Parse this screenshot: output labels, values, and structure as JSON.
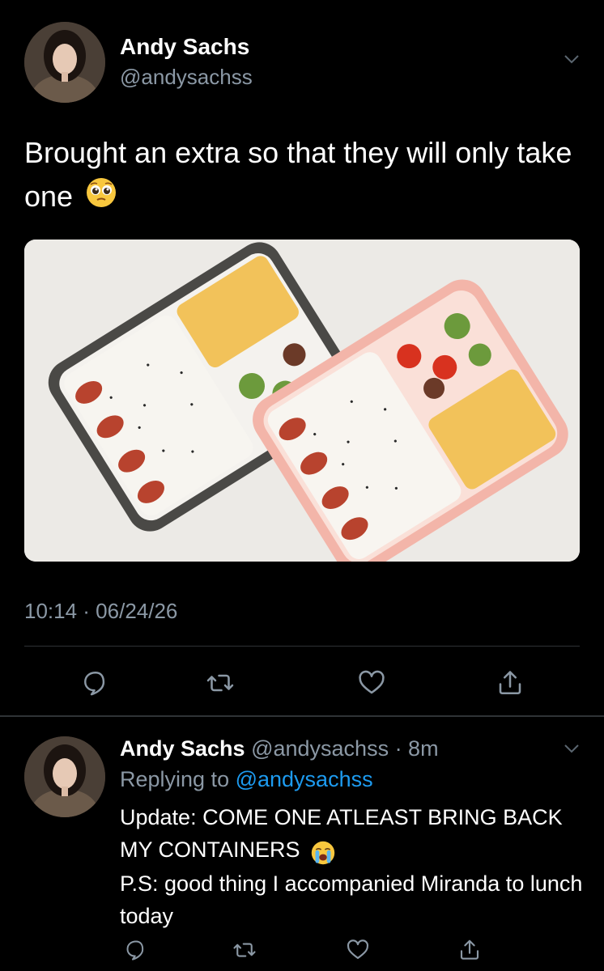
{
  "tweet": {
    "display_name": "Andy Sachs",
    "handle": "@andysachss",
    "text": "Brought an extra so that they will only take one",
    "emoji": "pleading-face-emoji",
    "timestamp": "10:14 · 06/24/26",
    "photo_alt": "Two bento lunch boxes with rice, octopus sausages, tomatoes, cucumber, rolled omelette and meatballs"
  },
  "reply": {
    "display_name": "Andy Sachs",
    "handle_time": "@andysachss · 8m",
    "replying_prefix": "Replying to ",
    "replying_to": "@andysachss",
    "line1": "Update: COME ONE ATLEAST BRING BACK MY CONTAINERS",
    "emoji": "loudly-crying-face-emoji",
    "line2": "P.S: good thing I accompanied Miranda to lunch today"
  },
  "actions": [
    "reply-icon",
    "retweet-icon",
    "like-icon",
    "share-icon"
  ],
  "colors": {
    "background": "#000000",
    "secondary_text": "#8b98a5",
    "link": "#1d9bf0",
    "divider": "#2f3336"
  }
}
